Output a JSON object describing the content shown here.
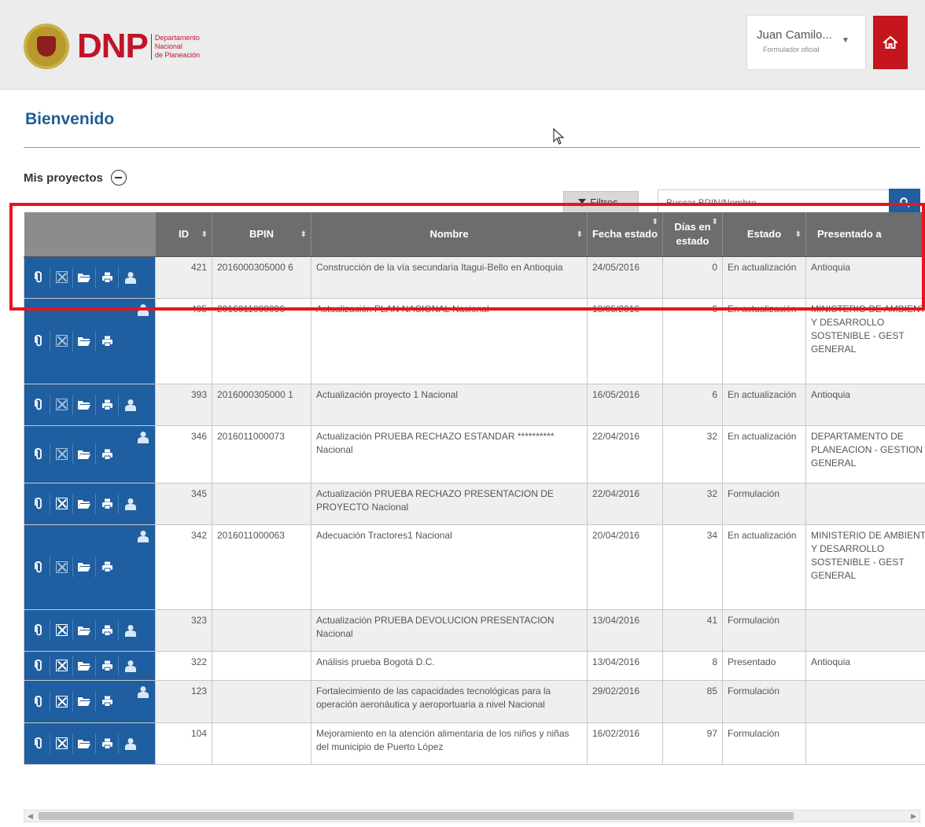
{
  "header": {
    "logo_text": "DNP",
    "logo_sub": [
      "Departamento",
      "Nacional",
      "de Planeación"
    ],
    "user_name": "Juan Camilo...",
    "user_role": "Formulador oficial"
  },
  "page": {
    "title": "Bienvenido",
    "section": "Mis proyectos",
    "filter_label": "Filtros..",
    "search_placeholder": "Buscar BPIN/Nombre"
  },
  "table": {
    "columns": [
      "ID",
      "BPIN",
      "Nombre",
      "Fecha estado",
      "Días en estado",
      "Estado",
      "Presentado a"
    ],
    "rows": [
      {
        "id": "421",
        "bpin": "2016000305000 6",
        "nombre": "Construcción de la vía secundaria Itagui-Bello en Antioquia",
        "fecha": "24/05/2016",
        "dias": "0",
        "estado": "En actualización",
        "presentado": "Antioquia"
      },
      {
        "id": "405",
        "bpin": "2016011000096",
        "nombre": "Actualización PLAN NACIONAL  Nacional",
        "fecha": "18/05/2016",
        "dias": "6",
        "estado": "En actualización",
        "presentado": "MINISTERIO DE AMBIENTE Y DESARROLLO SOSTENIBLE - GEST GENERAL"
      },
      {
        "id": "393",
        "bpin": "2016000305000 1",
        "nombre": "Actualización proyecto 1  Nacional",
        "fecha": "16/05/2016",
        "dias": "6",
        "estado": "En actualización",
        "presentado": "Antioquia"
      },
      {
        "id": "346",
        "bpin": "2016011000073",
        "nombre": "Actualización PRUEBA RECHAZO ESTANDAR ********** Nacional",
        "fecha": "22/04/2016",
        "dias": "32",
        "estado": "En actualización",
        "presentado": "DEPARTAMENTO DE PLANEACION - GESTION GENERAL"
      },
      {
        "id": "345",
        "bpin": "",
        "nombre": "Actualización PRUEBA RECHAZO PRESENTACION DE PROYECTO  Nacional",
        "fecha": "22/04/2016",
        "dias": "32",
        "estado": "Formulación",
        "presentado": ""
      },
      {
        "id": "342",
        "bpin": "2016011000063",
        "nombre": "Adecuación Tractores1  Nacional",
        "fecha": "20/04/2016",
        "dias": "34",
        "estado": "En actualización",
        "presentado": "MINISTERIO DE AMBIENTE Y DESARROLLO SOSTENIBLE - GEST GENERAL"
      },
      {
        "id": "323",
        "bpin": "",
        "nombre": "Actualización PRUEBA DEVOLUCION PRESENTACION  Nacional",
        "fecha": "13/04/2016",
        "dias": "41",
        "estado": "Formulación",
        "presentado": ""
      },
      {
        "id": "322",
        "bpin": "",
        "nombre": "Análisis prueba  Bogotá D.C.",
        "fecha": "13/04/2016",
        "dias": "8",
        "estado": "Presentado",
        "presentado": "Antioquia"
      },
      {
        "id": "123",
        "bpin": "",
        "nombre": "Fortalecimiento de las capacidades tecnológicas para la operación aeronáutica y aeroportuaria a nivel Nacional",
        "fecha": "29/02/2016",
        "dias": "85",
        "estado": "Formulación",
        "presentado": ""
      },
      {
        "id": "104",
        "bpin": "",
        "nombre": "Mejoramiento en la atención alimentaria de los niños y niñas del municipio de  Puerto López",
        "fecha": "16/02/2016",
        "dias": "97",
        "estado": "Formulación",
        "presentado": ""
      }
    ]
  },
  "colors": {
    "brand_red": "#c4161c",
    "brand_blue": "#1f5ea0",
    "header_gray": "#6d6d6d",
    "highlight": "#e8151b"
  }
}
